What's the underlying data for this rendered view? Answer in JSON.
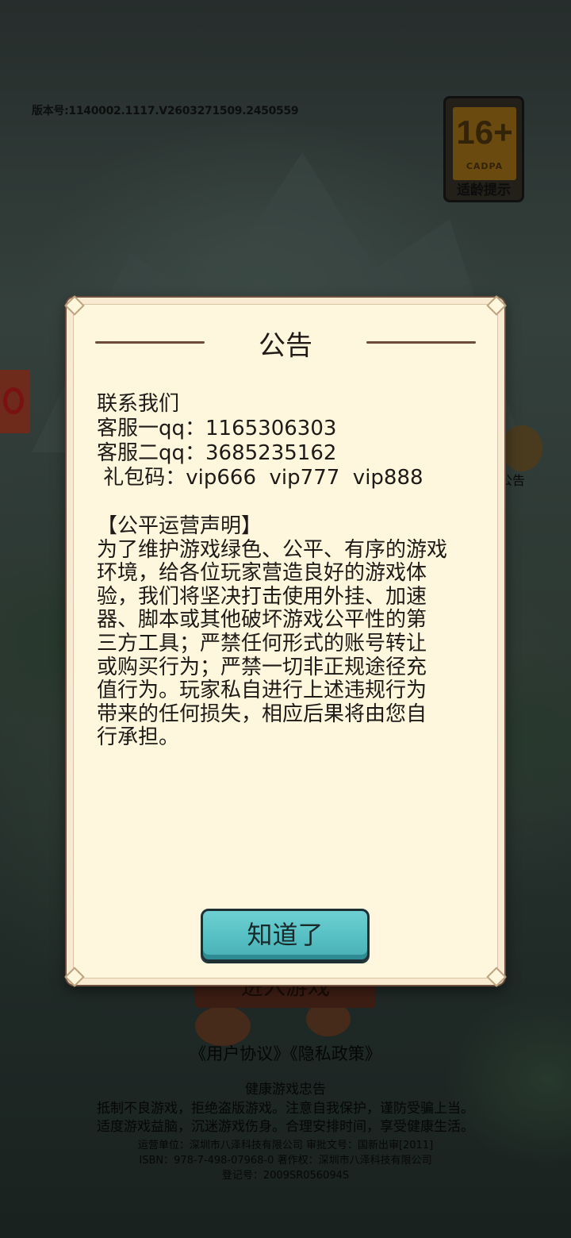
{
  "version": "版本号:1140002.1117.V2603271509.2450559",
  "age_rating": {
    "number": "16+",
    "org": "CADPA",
    "tip": "适龄提示"
  },
  "side_right_label": "公告",
  "background_button_label": "进入游戏",
  "agreement": {
    "user": "《用户协议》",
    "privacy": "《隐私政策》"
  },
  "health_notice": {
    "title": "健康游戏忠告",
    "line1": "抵制不良游戏，拒绝盗版游戏。注意自我保护，谨防受骗上当。",
    "line2": "适度游戏益脑，沉迷游戏伤身。合理安排时间，享受健康生活。",
    "publisher": "运营单位：深圳市八泽科技有限公司  审批文号：国新出审[2011]",
    "isbn": "ISBN：978-7-498-07968-0  著作权：深圳市八泽科技有限公司",
    "reg": "登记号：2009SR056094S"
  },
  "dialog": {
    "title": "公告",
    "contact": [
      "联系我们",
      "客服一qq：1165306303",
      "客服二qq：3685235162",
      " 礼包码：vip666  vip777  vip888"
    ],
    "statement_title": "【公平运营声明】",
    "statement_lines": [
      "为了维护游戏绿色、公平、有序的游戏",
      "环境，给各位玩家营造良好的游戏体",
      "验，我们将坚决打击使用外挂、加速",
      "器、脚本或其他破坏游戏公平性的第",
      "三方工具；严禁任何形式的账号转让",
      "或购买行为；严禁一切非正规途径充",
      "值行为。玩家私自进行上述违规行为",
      "带来的任何损失，相应后果将由您自",
      "行承担。"
    ],
    "ok_label": "知道了"
  },
  "colors": {
    "dialog_bg": "#fef6dd",
    "dialog_border": "#6e4e3c",
    "button_teal": "#55bfc3",
    "text_dark": "#1e1a17"
  }
}
